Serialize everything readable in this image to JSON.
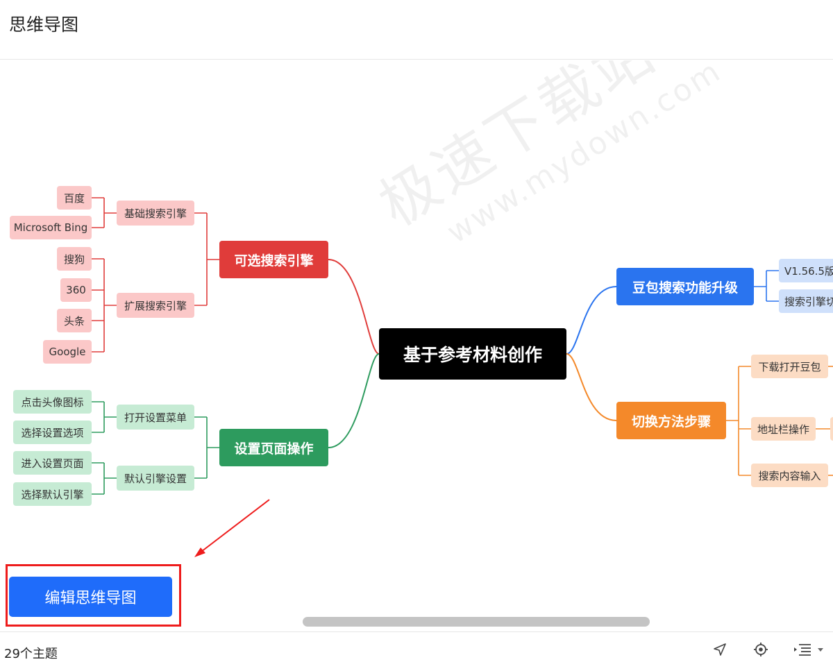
{
  "header": {
    "title": "思维导图"
  },
  "mindmap": {
    "root": "基于参考材料创作",
    "branches": {
      "search_engines": {
        "label": "可选搜索引擎",
        "color": "#e03c3a",
        "basic": {
          "label": "基础搜索引擎",
          "items": [
            "百度",
            "Microsoft Bing"
          ]
        },
        "extended": {
          "label": "扩展搜索引擎",
          "items": [
            "搜狗",
            "360",
            "头条",
            "Google"
          ]
        }
      },
      "settings": {
        "label": "设置页面操作",
        "color": "#2d9b5e",
        "open_menu": {
          "label": "打开设置菜单",
          "items": [
            "点击头像图标",
            "选择设置选项"
          ]
        },
        "default_engine": {
          "label": "默认引擎设置",
          "items": [
            "进入设置页面",
            "选择默认引擎"
          ]
        }
      },
      "upgrade": {
        "label": "豆包搜索功能升级",
        "color": "#2a74ef",
        "items": [
          "V1.56.5版",
          "搜索引擎切"
        ]
      },
      "steps": {
        "label": "切换方法步骤",
        "color": "#f4892a",
        "items": [
          "下载打开豆包",
          "地址栏操作",
          "搜索内容输入"
        ]
      }
    }
  },
  "watermark": {
    "chinese": "极速下载站",
    "url": "www.mydown.com"
  },
  "edit_button": {
    "label": "编辑思维导图"
  },
  "annotation_color": "#ee1c1c",
  "footer": {
    "topic_count": "29个主题",
    "icons": [
      "locate-arrow-icon",
      "center-target-icon",
      "outline-list-icon"
    ]
  }
}
